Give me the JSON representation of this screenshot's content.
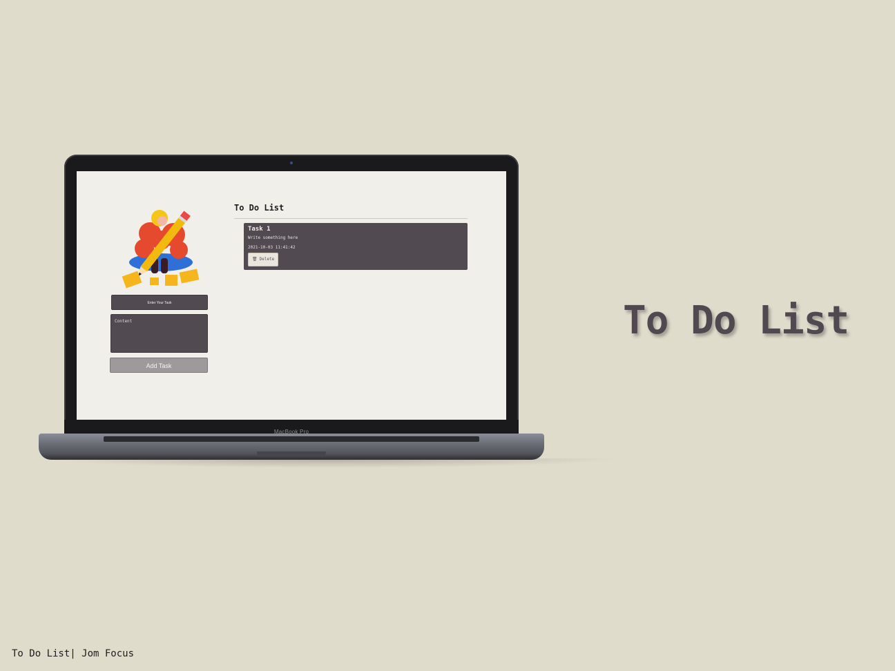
{
  "app": {
    "list_title": "To Do List",
    "task_input_placeholder": "Enter Your Task",
    "content_placeholder": "Content",
    "add_button_label": "Add Task",
    "tasks": [
      {
        "title": "Task 1",
        "body": "Write something here",
        "timestamp": "2021-10-03 11:41:42",
        "delete_label": "Delete",
        "delete_icon": "trash-icon"
      }
    ]
  },
  "device": {
    "brand_label": "MacBook Pro"
  },
  "hero": {
    "title": "To Do List"
  },
  "footer": {
    "caption": "To Do List| Jom Focus"
  },
  "colors": {
    "background": "#e0dccc",
    "screen": "#f1efea",
    "card": "#524a51",
    "accent_text": "#514950"
  }
}
